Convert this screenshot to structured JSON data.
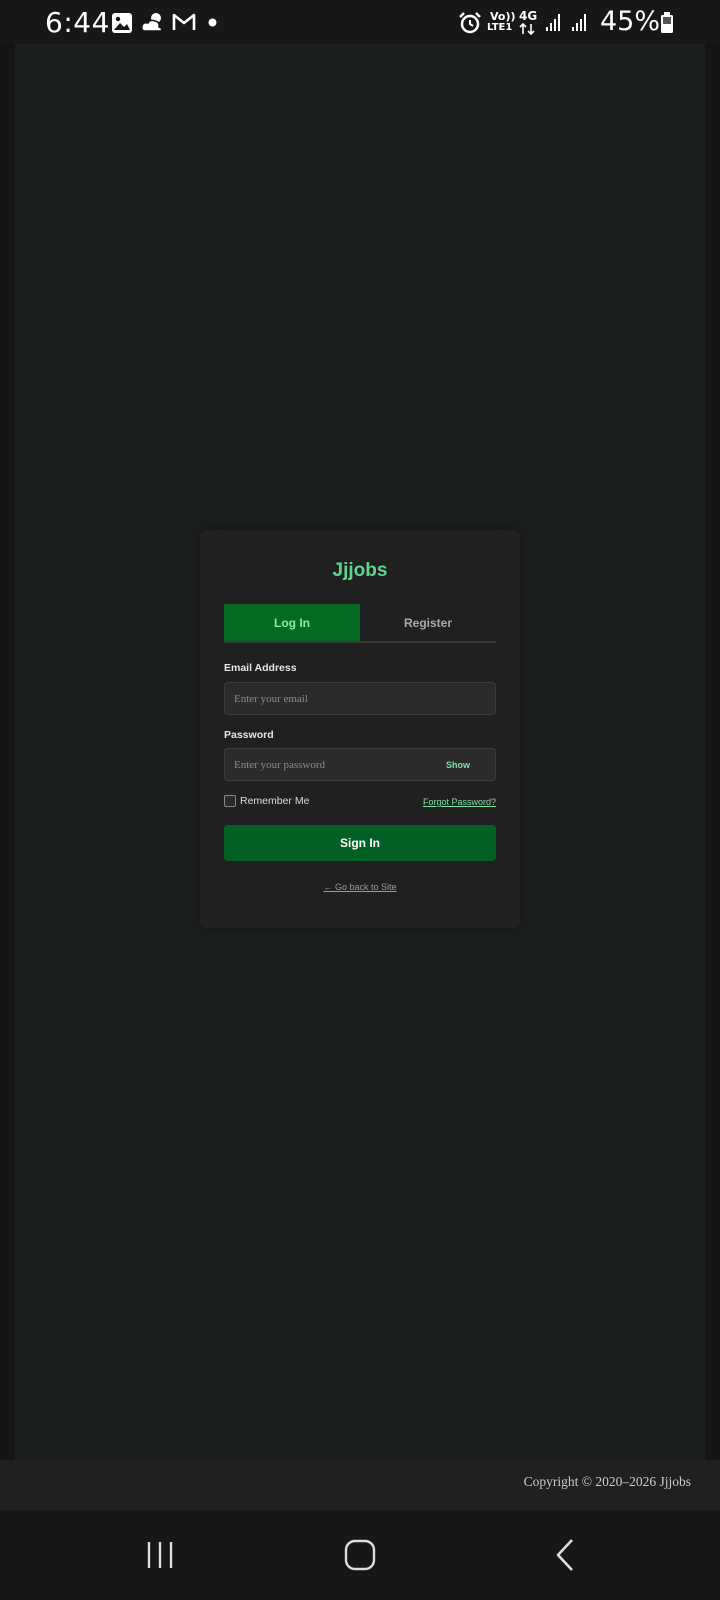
{
  "status_bar": {
    "time": "6:44",
    "network_volte": "Vo))",
    "network_lte": "LTE1",
    "network_type": "4G",
    "battery": "45%",
    "icons": [
      "gallery-icon",
      "weather-icon",
      "gmail-icon",
      "dot-icon",
      "alarm-icon",
      "signal-icon",
      "signal-icon",
      "battery-icon"
    ]
  },
  "login": {
    "brand": "Jjjobs",
    "tabs": [
      {
        "label": "Log In",
        "active": true
      },
      {
        "label": "Register",
        "active": false
      }
    ],
    "email_label": "Email Address",
    "email_placeholder": "Enter your email",
    "password_label": "Password",
    "password_placeholder": "Enter your password",
    "show_label": "Show",
    "remember_label": "Remember Me",
    "forgot_label": "Forgot Password?",
    "submit_label": "Sign In",
    "back_label": "← Go back to Site"
  },
  "footer": {
    "copyright": "Copyright © 2020–2026 Jjjobs"
  },
  "colors": {
    "accent": "#5fd48c",
    "button": "#036024",
    "tab_active": "#056b23",
    "background": "#1a1e1c"
  },
  "nav": [
    "recent-apps-icon",
    "home-icon",
    "back-icon"
  ]
}
